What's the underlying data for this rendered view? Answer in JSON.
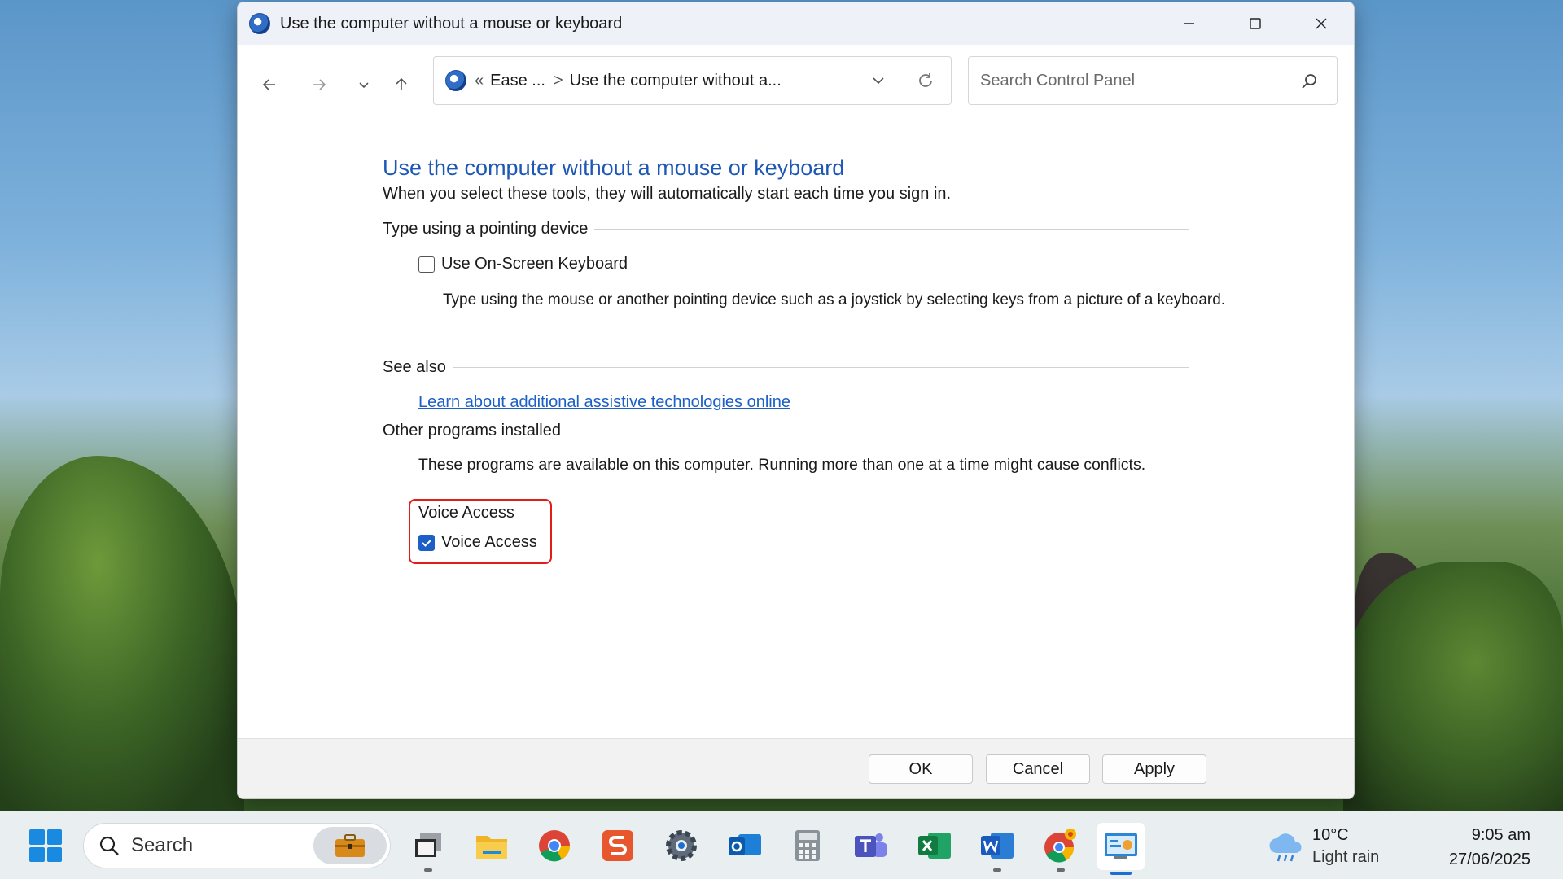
{
  "window": {
    "title": "Use the computer without a mouse or keyboard",
    "controls": {
      "minimize": "—",
      "maximize": "☐",
      "close": "✕"
    }
  },
  "navigation": {
    "breadcrumb_prefix": "«",
    "breadcrumbs": [
      "Ease ...",
      "Use the computer without a..."
    ],
    "separator": ">",
    "search_placeholder": "Search Control Panel"
  },
  "main": {
    "heading": "Use the computer without a mouse or keyboard",
    "subheading": "When you select these tools, they will automatically start each time you sign in.",
    "pointing_section": {
      "title": "Type using a pointing device",
      "checkbox_label": "Use On-Screen Keyboard",
      "checked": false,
      "description": "Type using the mouse or another pointing device such as a joystick by selecting keys from a picture of a keyboard."
    },
    "see_also": {
      "title": "See also",
      "link": "Learn about additional assistive technologies online"
    },
    "other_programs": {
      "title": "Other programs installed",
      "note": "These programs are available on this computer. Running more than one at a time might cause conflicts.",
      "program_heading": "Voice Access",
      "checkbox_label": "Voice Access",
      "checked": true
    }
  },
  "footer": {
    "ok": "OK",
    "cancel": "Cancel",
    "apply": "Apply"
  },
  "taskbar": {
    "search_label": "Search",
    "apps": [
      "Task View",
      "File Explorer",
      "Chrome",
      "Slides",
      "Settings",
      "Outlook",
      "Calculator",
      "Teams",
      "Excel",
      "Word",
      "Chrome Canary",
      "Control Panel"
    ],
    "weather": {
      "temp": "10°C",
      "condition": "Light rain"
    },
    "clock": {
      "time": "9:05 am",
      "date": "27/06/2025"
    }
  },
  "colors": {
    "link": "#1c5fc7",
    "heading": "#1c57b5",
    "highlight": "#e21b1b",
    "accent": "#1a6fd1"
  }
}
